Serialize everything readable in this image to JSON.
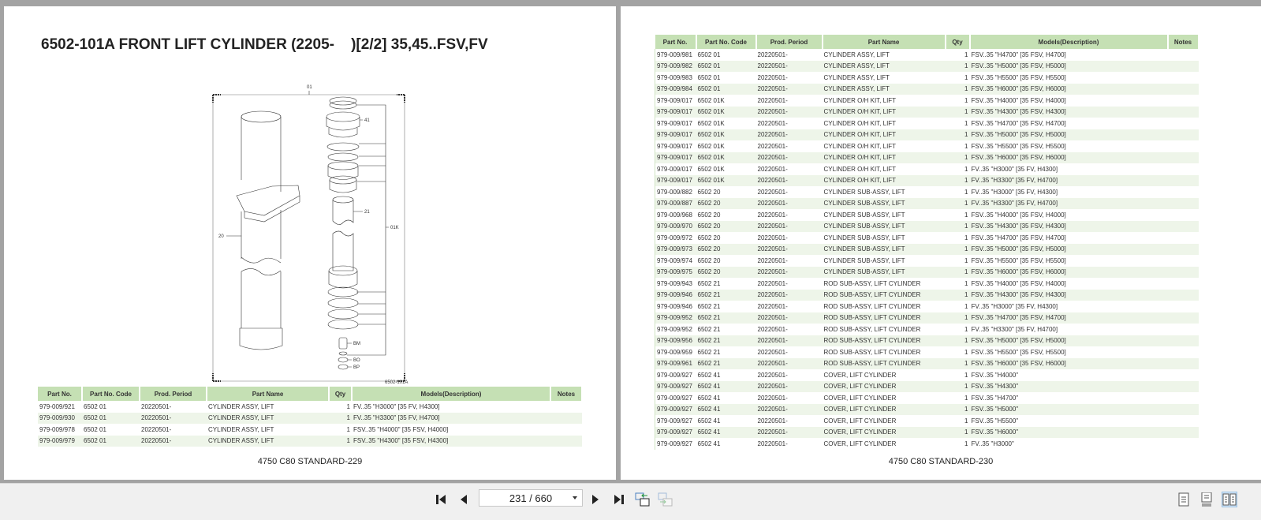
{
  "left_page": {
    "title": "6502-101A FRONT LIFT CYLINDER (2205-    )[2/2] 35,45..FSV,FV",
    "diagram_labels": {
      "top": "01",
      "cover": "41",
      "rod": "21",
      "kit": "01K",
      "tube": "20",
      "bm": "BM",
      "bo": "BO",
      "bp": "BP",
      "figure": "6502-101A"
    },
    "footer": "4750 C80 STANDARD-229",
    "rows": [
      [
        "979-009/921",
        "6502 01",
        "20220501-",
        "CYLINDER ASSY, LIFT",
        "1",
        "FV..35 \"H3000\" [35 FV, H4300]",
        ""
      ],
      [
        "979-009/930",
        "6502 01",
        "20220501-",
        "CYLINDER ASSY, LIFT",
        "1",
        "FV..35 \"H3300\" [35 FV, H4700]",
        ""
      ],
      [
        "979-009/978",
        "6502 01",
        "20220501-",
        "CYLINDER ASSY, LIFT",
        "1",
        "FSV..35 \"H4000\" [35 FSV, H4000]",
        ""
      ],
      [
        "979-009/979",
        "6502 01",
        "20220501-",
        "CYLINDER ASSY, LIFT",
        "1",
        "FSV..35 \"H4300\" [35 FSV, H4300]",
        ""
      ]
    ]
  },
  "columns": [
    "Part No.",
    "Part No. Code",
    "Prod. Period",
    "Part Name",
    "Qty",
    "Models(Description)",
    "Notes"
  ],
  "right_page": {
    "footer": "4750 C80 STANDARD-230",
    "rows": [
      [
        "979-009/981",
        "6502 01",
        "20220501-",
        "CYLINDER ASSY, LIFT",
        "1",
        "FSV..35 \"H4700\" [35 FSV, H4700]",
        ""
      ],
      [
        "979-009/982",
        "6502 01",
        "20220501-",
        "CYLINDER ASSY, LIFT",
        "1",
        "FSV..35 \"H5000\" [35 FSV, H5000]",
        ""
      ],
      [
        "979-009/983",
        "6502 01",
        "20220501-",
        "CYLINDER ASSY, LIFT",
        "1",
        "FSV..35 \"H5500\" [35 FSV, H5500]",
        ""
      ],
      [
        "979-009/984",
        "6502 01",
        "20220501-",
        "CYLINDER ASSY, LIFT",
        "1",
        "FSV..35 \"H6000\" [35 FSV, H6000]",
        ""
      ],
      [
        "979-009/017",
        "6502 01K",
        "20220501-",
        "CYLINDER O/H KIT, LIFT",
        "1",
        "FSV..35 \"H4000\" [35 FSV, H4000]",
        ""
      ],
      [
        "979-009/017",
        "6502 01K",
        "20220501-",
        "CYLINDER O/H KIT, LIFT",
        "1",
        "FSV..35 \"H4300\" [35 FSV, H4300]",
        ""
      ],
      [
        "979-009/017",
        "6502 01K",
        "20220501-",
        "CYLINDER O/H KIT, LIFT",
        "1",
        "FSV..35 \"H4700\" [35 FSV, H4700]",
        ""
      ],
      [
        "979-009/017",
        "6502 01K",
        "20220501-",
        "CYLINDER O/H KIT, LIFT",
        "1",
        "FSV..35 \"H5000\" [35 FSV, H5000]",
        ""
      ],
      [
        "979-009/017",
        "6502 01K",
        "20220501-",
        "CYLINDER O/H KIT, LIFT",
        "1",
        "FSV..35 \"H5500\" [35 FSV, H5500]",
        ""
      ],
      [
        "979-009/017",
        "6502 01K",
        "20220501-",
        "CYLINDER O/H KIT, LIFT",
        "1",
        "FSV..35 \"H6000\" [35 FSV, H6000]",
        ""
      ],
      [
        "979-009/017",
        "6502 01K",
        "20220501-",
        "CYLINDER O/H KIT, LIFT",
        "1",
        "FV..35 \"H3000\" [35 FV, H4300]",
        ""
      ],
      [
        "979-009/017",
        "6502 01K",
        "20220501-",
        "CYLINDER O/H KIT, LIFT",
        "1",
        "FV..35 \"H3300\" [35 FV, H4700]",
        ""
      ],
      [
        "979-009/882",
        "6502 20",
        "20220501-",
        "CYLINDER SUB-ASSY, LIFT",
        "1",
        "FV..35 \"H3000\" [35 FV, H4300]",
        ""
      ],
      [
        "979-009/887",
        "6502 20",
        "20220501-",
        "CYLINDER SUB-ASSY, LIFT",
        "1",
        "FV..35 \"H3300\" [35 FV, H4700]",
        ""
      ],
      [
        "979-009/968",
        "6502 20",
        "20220501-",
        "CYLINDER SUB-ASSY, LIFT",
        "1",
        "FSV..35 \"H4000\" [35 FSV, H4000]",
        ""
      ],
      [
        "979-009/970",
        "6502 20",
        "20220501-",
        "CYLINDER SUB-ASSY, LIFT",
        "1",
        "FSV..35 \"H4300\" [35 FSV, H4300]",
        ""
      ],
      [
        "979-009/972",
        "6502 20",
        "20220501-",
        "CYLINDER SUB-ASSY, LIFT",
        "1",
        "FSV..35 \"H4700\" [35 FSV, H4700]",
        ""
      ],
      [
        "979-009/973",
        "6502 20",
        "20220501-",
        "CYLINDER SUB-ASSY, LIFT",
        "1",
        "FSV..35 \"H5000\" [35 FSV, H5000]",
        ""
      ],
      [
        "979-009/974",
        "6502 20",
        "20220501-",
        "CYLINDER SUB-ASSY, LIFT",
        "1",
        "FSV..35 \"H5500\" [35 FSV, H5500]",
        ""
      ],
      [
        "979-009/975",
        "6502 20",
        "20220501-",
        "CYLINDER SUB-ASSY, LIFT",
        "1",
        "FSV..35 \"H6000\" [35 FSV, H6000]",
        ""
      ],
      [
        "979-009/943",
        "6502 21",
        "20220501-",
        "ROD SUB-ASSY, LIFT CYLINDER",
        "1",
        "FSV..35 \"H4000\" [35 FSV, H4000]",
        ""
      ],
      [
        "979-009/946",
        "6502 21",
        "20220501-",
        "ROD SUB-ASSY, LIFT CYLINDER",
        "1",
        "FSV..35 \"H4300\" [35 FSV, H4300]",
        ""
      ],
      [
        "979-009/946",
        "6502 21",
        "20220501-",
        "ROD SUB-ASSY, LIFT CYLINDER",
        "1",
        "FV..35 \"H3000\" [35 FV, H4300]",
        ""
      ],
      [
        "979-009/952",
        "6502 21",
        "20220501-",
        "ROD SUB-ASSY, LIFT CYLINDER",
        "1",
        "FSV..35 \"H4700\" [35 FSV, H4700]",
        ""
      ],
      [
        "979-009/952",
        "6502 21",
        "20220501-",
        "ROD SUB-ASSY, LIFT CYLINDER",
        "1",
        "FV..35 \"H3300\" [35 FV, H4700]",
        ""
      ],
      [
        "979-009/956",
        "6502 21",
        "20220501-",
        "ROD SUB-ASSY, LIFT CYLINDER",
        "1",
        "FSV..35 \"H5000\" [35 FSV, H5000]",
        ""
      ],
      [
        "979-009/959",
        "6502 21",
        "20220501-",
        "ROD SUB-ASSY, LIFT CYLINDER",
        "1",
        "FSV..35 \"H5500\" [35 FSV, H5500]",
        ""
      ],
      [
        "979-009/961",
        "6502 21",
        "20220501-",
        "ROD SUB-ASSY, LIFT CYLINDER",
        "1",
        "FSV..35 \"H6000\" [35 FSV, H6000]",
        ""
      ],
      [
        "979-009/927",
        "6502 41",
        "20220501-",
        "COVER, LIFT CYLINDER",
        "1",
        "FSV..35 \"H4000\"",
        ""
      ],
      [
        "979-009/927",
        "6502 41",
        "20220501-",
        "COVER, LIFT CYLINDER",
        "1",
        "FSV..35 \"H4300\"",
        ""
      ],
      [
        "979-009/927",
        "6502 41",
        "20220501-",
        "COVER, LIFT CYLINDER",
        "1",
        "FSV..35 \"H4700\"",
        ""
      ],
      [
        "979-009/927",
        "6502 41",
        "20220501-",
        "COVER, LIFT CYLINDER",
        "1",
        "FSV..35 \"H5000\"",
        ""
      ],
      [
        "979-009/927",
        "6502 41",
        "20220501-",
        "COVER, LIFT CYLINDER",
        "1",
        "FSV..35 \"H5500\"",
        ""
      ],
      [
        "979-009/927",
        "6502 41",
        "20220501-",
        "COVER, LIFT CYLINDER",
        "1",
        "FSV..35 \"H6000\"",
        ""
      ],
      [
        "979-009/927",
        "6502 41",
        "20220501-",
        "COVER, LIFT CYLINDER",
        "1",
        "FV..35 \"H3000\"",
        ""
      ]
    ]
  },
  "toolbar": {
    "page_indicator": "231 / 660",
    "icons": [
      "first-page-icon",
      "prev-page-icon",
      "next-page-icon",
      "last-page-icon",
      "go-back-view-icon",
      "go-forward-view-icon",
      "single-page-icon",
      "continuous-page-icon",
      "two-page-icon"
    ],
    "active_color": "#cfe3f5"
  }
}
